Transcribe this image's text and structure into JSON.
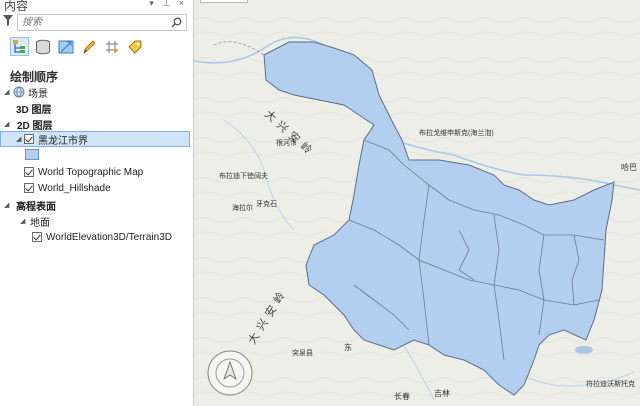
{
  "pane": {
    "title": "内容",
    "controls": "▾ ⊥ ×"
  },
  "search": {
    "placeholder": "搜索"
  },
  "toolbar": {
    "icons": [
      "list-by-drawing-order-icon",
      "list-by-source-icon",
      "list-by-selection-icon",
      "list-by-editing-icon",
      "list-by-snapping-icon",
      "list-by-labeling-icon"
    ]
  },
  "drawing_order": {
    "title": "绘制顺序",
    "scene": "场景",
    "layers_3d": "3D 图层",
    "layers_2d": "2D 图层",
    "layer_heilongjiang": "黑龙江市界",
    "layer_topo": "World Topographic Map",
    "layer_hillshade": "World_Hillshade",
    "elevation": "高程表面",
    "ground": "地面",
    "elevation_source": "WorldElevation3D/Terrain3D"
  },
  "map": {
    "labels": {
      "daxinganling_1": "大兴安岭",
      "daxinganling_2": "大兴安岭",
      "genhe": "根河市",
      "buladi": "布拉迪下徳阔夫",
      "hailaer": "海拉尔",
      "yakeshi": "牙克石",
      "bulagov": "布拉戈维申斯克(海兰泡)",
      "haba": "哈巴",
      "tuquan": "突泉县",
      "dong": "东",
      "changchun": "长春",
      "jilin": "吉林",
      "fuladi": "符拉迪沃斯托克"
    },
    "colors": {
      "region_fill": "#b3cff0",
      "region_stroke": "#5d6f86",
      "base": "#edeee8",
      "river": "#a7c9e6"
    }
  }
}
